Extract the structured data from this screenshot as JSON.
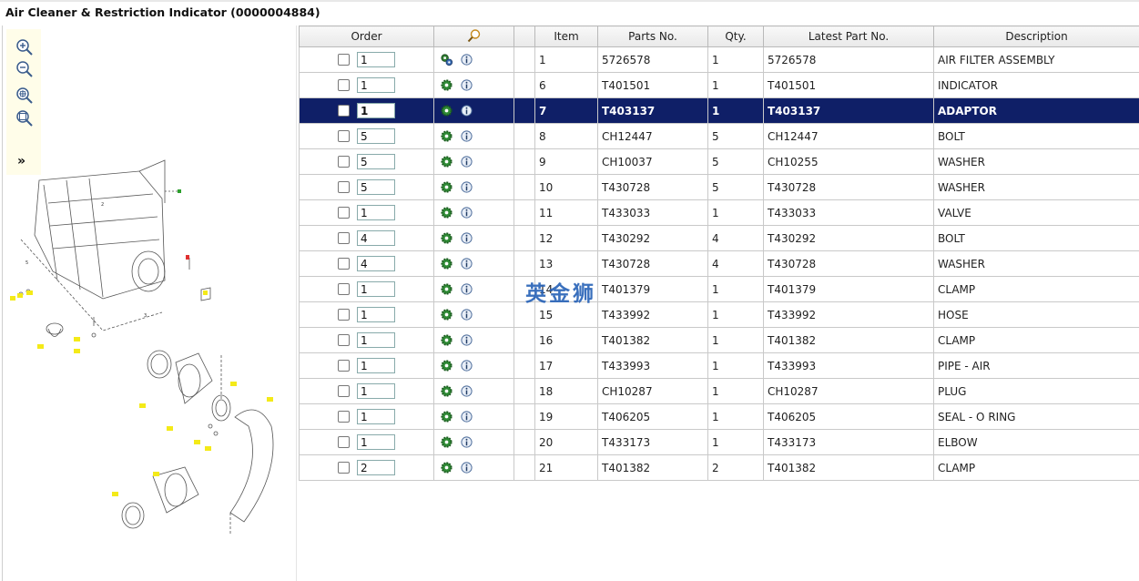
{
  "title": "Air Cleaner & Restriction Indicator (0000004884)",
  "toolbar": {
    "zoom_in_icon": "zoom-in-icon",
    "zoom_out_icon": "zoom-out-icon",
    "zoom_fit_icon": "zoom-fit-icon",
    "zoom_reset_icon": "zoom-reset-icon",
    "expand_label": "»"
  },
  "grid": {
    "headers": {
      "order": "Order",
      "item": "Item",
      "parts_no": "Parts No.",
      "qty": "Qty.",
      "latest": "Latest Part No.",
      "description": "Description"
    },
    "rows": [
      {
        "order": "1",
        "item": "1",
        "parts_no": "5726578",
        "qty": "1",
        "latest": "5726578",
        "description": "AIR FILTER ASSEMBLY"
      },
      {
        "order": "1",
        "item": "6",
        "parts_no": "T401501",
        "qty": "1",
        "latest": "T401501",
        "description": "INDICATOR"
      },
      {
        "order": "1",
        "item": "7",
        "parts_no": "T403137",
        "qty": "1",
        "latest": "T403137",
        "description": "ADAPTOR"
      },
      {
        "order": "5",
        "item": "8",
        "parts_no": "CH12447",
        "qty": "5",
        "latest": "CH12447",
        "description": "BOLT"
      },
      {
        "order": "5",
        "item": "9",
        "parts_no": "CH10037",
        "qty": "5",
        "latest": "CH10255",
        "description": "WASHER"
      },
      {
        "order": "5",
        "item": "10",
        "parts_no": "T430728",
        "qty": "5",
        "latest": "T430728",
        "description": "WASHER"
      },
      {
        "order": "1",
        "item": "11",
        "parts_no": "T433033",
        "qty": "1",
        "latest": "T433033",
        "description": "VALVE"
      },
      {
        "order": "4",
        "item": "12",
        "parts_no": "T430292",
        "qty": "4",
        "latest": "T430292",
        "description": "BOLT"
      },
      {
        "order": "4",
        "item": "13",
        "parts_no": "T430728",
        "qty": "4",
        "latest": "T430728",
        "description": "WASHER"
      },
      {
        "order": "1",
        "item": "14",
        "parts_no": "T401379",
        "qty": "1",
        "latest": "T401379",
        "description": "CLAMP"
      },
      {
        "order": "1",
        "item": "15",
        "parts_no": "T433992",
        "qty": "1",
        "latest": "T433992",
        "description": "HOSE"
      },
      {
        "order": "1",
        "item": "16",
        "parts_no": "T401382",
        "qty": "1",
        "latest": "T401382",
        "description": "CLAMP"
      },
      {
        "order": "1",
        "item": "17",
        "parts_no": "T433993",
        "qty": "1",
        "latest": "T433993",
        "description": "PIPE - AIR"
      },
      {
        "order": "1",
        "item": "18",
        "parts_no": "CH10287",
        "qty": "1",
        "latest": "CH10287",
        "description": "PLUG"
      },
      {
        "order": "1",
        "item": "19",
        "parts_no": "T406205",
        "qty": "1",
        "latest": "T406205",
        "description": "SEAL - O RING"
      },
      {
        "order": "1",
        "item": "20",
        "parts_no": "T433173",
        "qty": "1",
        "latest": "T433173",
        "description": "ELBOW"
      },
      {
        "order": "2",
        "item": "21",
        "parts_no": "T401382",
        "qty": "2",
        "latest": "T401382",
        "description": "CLAMP"
      }
    ]
  },
  "watermark": "英金狮"
}
